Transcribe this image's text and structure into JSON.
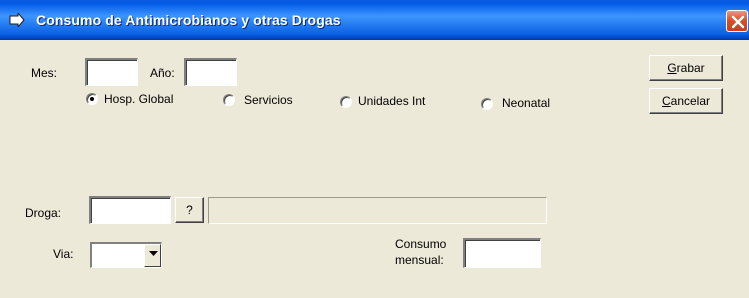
{
  "window": {
    "title": "Consumo de Antimicrobianos y otras Drogas"
  },
  "fields": {
    "mes_label": "Mes:",
    "mes_value": "",
    "ano_label": "Año:",
    "ano_value": "",
    "droga_label": "Droga:",
    "droga_value": "",
    "droga_lookup_label": "?",
    "droga_description": "",
    "via_label": "Via:",
    "via_value": "",
    "consumo_label_line1": "Consumo",
    "consumo_label_line2": "mensual:",
    "consumo_value": ""
  },
  "scope_options": [
    {
      "label": "Hosp. Global",
      "selected": true
    },
    {
      "label": "Servicios",
      "selected": false
    },
    {
      "label": "Unidades Int",
      "selected": false
    },
    {
      "label": "Neonatal",
      "selected": false
    }
  ],
  "buttons": {
    "grabar_mnemonic": "G",
    "grabar_rest": "rabar",
    "cancelar_mnemonic": "C",
    "cancelar_rest": "ancelar"
  },
  "icons": {
    "title_icon": "arrow-pointer-icon",
    "close_icon": "close-x-icon",
    "dropdown_icon": "chevron-down-icon"
  },
  "colors": {
    "titlebar": "#0058e6",
    "window_bg": "#ece9d8",
    "close_button": "#d9512b"
  }
}
